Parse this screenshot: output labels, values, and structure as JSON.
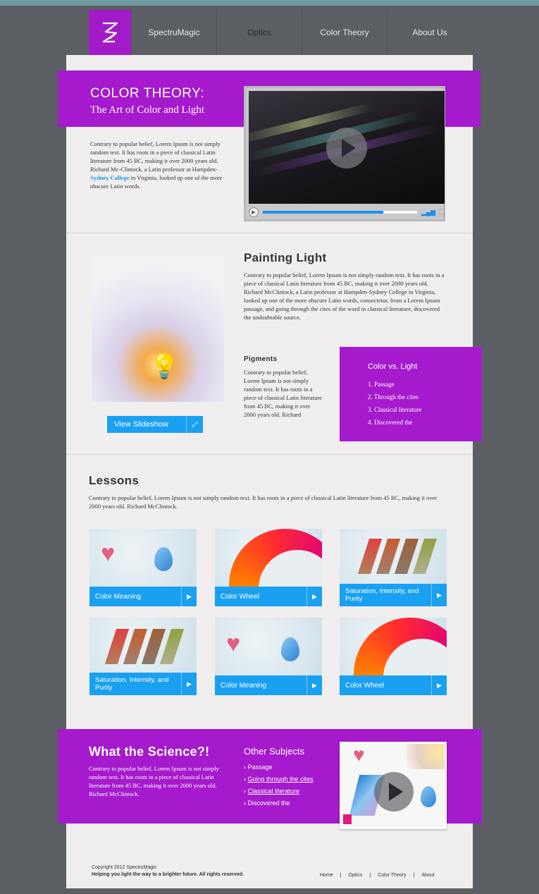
{
  "nav": {
    "items": [
      {
        "label": "SpectruMagic"
      },
      {
        "label": "Optics"
      },
      {
        "label": "Color Theory"
      },
      {
        "label": "About Us"
      }
    ]
  },
  "hero": {
    "title": "COLOR THEORY:",
    "subtitle": "The Art of Color and Light",
    "paragraph_before_link": "Contrary to popular belief, Lorem Ipsum is not simply random text. It has roots in a piece of classical Latin literature from 45 BC, making it over 2000 years old. Richard Mc-Clintock, a Latin professor at Hampden-",
    "link": "Sydney College",
    "paragraph_after_link": " in Virginia, looked up one of the more obscure Latin words.",
    "video": {
      "progress": 0.78
    }
  },
  "painting": {
    "title": "Painting Light",
    "paragraph": "Contrary to popular belief, Lorem Ipsum is not simply random text. It has roots in a piece of classical Latin literature from 45 BC, making it over 2000 years old. Richard McClintock, a Latin professor at Hampden-Sydney College in Virginia, looked up one of the more obscure Latin words, consectetur, from a Lorem Ipsum passage, and going through the cites of the word in classical literature, discovered the undoubtable source.",
    "slideshow_button": "View Slideshow"
  },
  "pigments": {
    "title": "Pigments",
    "paragraph": "Contrary to popular belief, Lorem Ipsum is not simply random text. It has roots in a piece of classical Latin literature from 45 BC, making it over 2000 years old. Richard"
  },
  "color_vs_light": {
    "title": "Color vs. Light",
    "items": [
      "1. Passage",
      "2. Through the cites",
      "3. Classical literature",
      "4. Discovered the"
    ]
  },
  "lessons": {
    "title": "Lessons",
    "paragraph": "Contrary to popular belief, Lorem Ipsum is not simply random text. It has roots in a piece of classical Latin literature from 45 BC, making it over 2000 years old. Richard McClintock.",
    "cards": [
      {
        "label": "Color Meaning",
        "art": "heart-drop"
      },
      {
        "label": "Color Wheel",
        "art": "wheel"
      },
      {
        "label": "Saturation, Intensity, and Purity",
        "art": "stripes"
      },
      {
        "label": "Saturation, Intensity, and Purity",
        "art": "stripes"
      },
      {
        "label": "Color Meaning",
        "art": "heart-drop"
      },
      {
        "label": "Color Wheel",
        "art": "wheel"
      }
    ]
  },
  "science": {
    "title": "What the Science?!",
    "paragraph": "Contrary to popular belief, Lorem Ipsum is not simply random text. It has roots in a piece of classical Latin literature from 45 BC, making it over 2000 years old. Richard McClintock.",
    "other_title": "Other Subjects",
    "other_items": [
      "Passage",
      "Going through the cites",
      "Classical literature",
      "Discovered the"
    ]
  },
  "footer": {
    "copyright": "Copyright 2012 SpectruMagic",
    "tagline": "Helping you light the way to a brighter future. All rights reserved.",
    "links": [
      "Home",
      "Optics",
      "Color Theory",
      "About"
    ],
    "separator": "|"
  },
  "colors": {
    "accent": "#a51acc",
    "blue": "#1aa0f0"
  }
}
